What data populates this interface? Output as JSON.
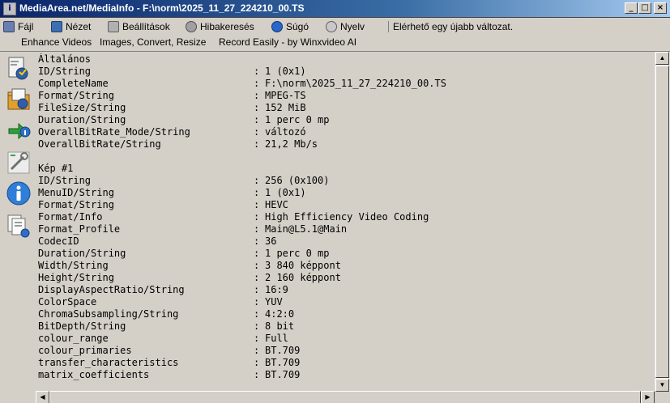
{
  "window": {
    "title": "MediaArea.net/MediaInfo - F:\\norm\\2025_11_27_224210_00.TS",
    "app_icon": "mediainfo-icon",
    "buttons": {
      "minimize": "_",
      "maximize": "□",
      "close": "×"
    }
  },
  "menu": {
    "items": [
      {
        "label": "Fájl",
        "icon": "file-icon"
      },
      {
        "label": "Nézet",
        "icon": "view-icon"
      },
      {
        "label": "Beállítások",
        "icon": "preferences-icon"
      },
      {
        "label": "Hibakeresés",
        "icon": "debug-icon"
      },
      {
        "label": "Súgó",
        "icon": "help-icon"
      },
      {
        "label": "Nyelv",
        "icon": "language-icon"
      }
    ],
    "update_notice": "Elérhető egy újabb változat."
  },
  "links": {
    "enhance": "Enhance Videos",
    "images": "Images, Convert, Resize",
    "record": "Record Easily - by Winxvideo AI"
  },
  "sidebar": {
    "icons": [
      "open-file-icon",
      "open-folder-icon",
      "export-icon",
      "preferences-icon",
      "info-icon",
      "sheet-view-icon"
    ]
  },
  "info": {
    "sections": [
      {
        "title": "Általános",
        "rows": [
          {
            "key": "ID/String",
            "value": "1 (0x1)"
          },
          {
            "key": "CompleteName",
            "value": "F:\\norm\\2025_11_27_224210_00.TS"
          },
          {
            "key": "Format/String",
            "value": "MPEG-TS"
          },
          {
            "key": "FileSize/String",
            "value": "152 MiB"
          },
          {
            "key": "Duration/String",
            "value": "1 perc 0 mp"
          },
          {
            "key": "OverallBitRate_Mode/String",
            "value": "változó"
          },
          {
            "key": "OverallBitRate/String",
            "value": "21,2 Mb/s"
          }
        ]
      },
      {
        "title": "Kép #1",
        "rows": [
          {
            "key": "ID/String",
            "value": "256 (0x100)"
          },
          {
            "key": "MenuID/String",
            "value": "1 (0x1)"
          },
          {
            "key": "Format/String",
            "value": "HEVC"
          },
          {
            "key": "Format/Info",
            "value": "High Efficiency Video Coding"
          },
          {
            "key": "Format_Profile",
            "value": "Main@L5.1@Main"
          },
          {
            "key": "CodecID",
            "value": "36"
          },
          {
            "key": "Duration/String",
            "value": "1 perc 0 mp"
          },
          {
            "key": "Width/String",
            "value": "3 840 képpont"
          },
          {
            "key": "Height/String",
            "value": "2 160 képpont"
          },
          {
            "key": "DisplayAspectRatio/String",
            "value": "16:9"
          },
          {
            "key": "ColorSpace",
            "value": "YUV"
          },
          {
            "key": "ChromaSubsampling/String",
            "value": "4:2:0"
          },
          {
            "key": "BitDepth/String",
            "value": "8 bit"
          },
          {
            "key": "colour_range",
            "value": "Full"
          },
          {
            "key": "colour_primaries",
            "value": "BT.709"
          },
          {
            "key": "transfer_characteristics",
            "value": "BT.709"
          },
          {
            "key": "matrix_coefficients",
            "value": "BT.709"
          }
        ]
      }
    ],
    "separator": ":"
  },
  "colors": {
    "title_start": "#0a246a",
    "title_end": "#a6caf0",
    "face": "#d4d0c8"
  }
}
